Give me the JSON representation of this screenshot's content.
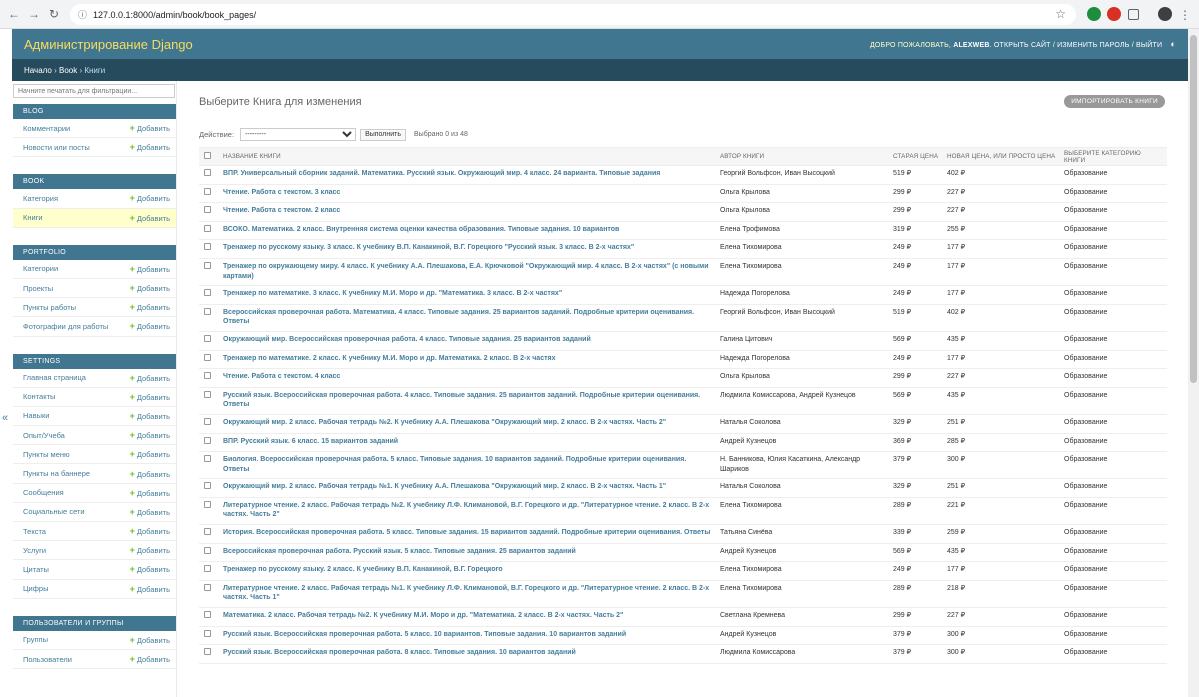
{
  "browser": {
    "url": "127.0.0.1:8000/admin/book/book_pages/"
  },
  "header": {
    "branding": "Администрирование Django",
    "welcome": "Добро пожаловать,",
    "username": "ALEXWEB",
    "view_site": "Открыть сайт",
    "change_password": "Изменить пароль",
    "logout": "Выйти"
  },
  "breadcrumbs": {
    "home": "Начало",
    "app": "Book",
    "current": "Книги"
  },
  "sidebar": {
    "filter_placeholder": "Начните печатать для фильтрации...",
    "add_label": "Добавить",
    "modules": [
      {
        "caption": "Blog",
        "items": [
          "Комментарии",
          "Новости или посты"
        ]
      },
      {
        "caption": "Book",
        "items": [
          "Категория",
          "Книги"
        ]
      },
      {
        "caption": "Portfolio",
        "items": [
          "Категории",
          "Проекты",
          "Пункты работы",
          "Фотографии для работы"
        ]
      },
      {
        "caption": "Settings",
        "items": [
          "Главная страница",
          "Контакты",
          "Навыки",
          "Опыт/Учеба",
          "Пункты меню",
          "Пункты на баннере",
          "Сообщения",
          "Социальные сети",
          "Текста",
          "Услуги",
          "Цитаты",
          "Цифры"
        ]
      },
      {
        "caption": "Пользователи и группы",
        "items": [
          "Группы",
          "Пользователи"
        ]
      }
    ]
  },
  "content": {
    "title": "Выберите Книга для изменения",
    "import_button": "Импортировать Книги",
    "action_label": "Действие:",
    "action_selected": "---------",
    "go_button": "Выполнить",
    "counter": "Выбрано 0 из 48",
    "columns": [
      "Название книги",
      "Автор книги",
      "Старая цена",
      "Новая цена, или просто цена",
      "Выберите категорию книги"
    ],
    "rows": [
      {
        "title": "ВПР. Универсальный сборник заданий. Математика. Русский язык. Окружающий мир. 4 класс. 24 варианта. Типовые задания",
        "author": "Георгий Вольфсон, Иван Высоцкий",
        "old": "519 ₽",
        "new": "402 ₽",
        "cat": "Образование"
      },
      {
        "title": "Чтение. Работа с текстом. 3 класс",
        "author": "Ольга Крылова",
        "old": "299 ₽",
        "new": "227 ₽",
        "cat": "Образование"
      },
      {
        "title": "Чтение. Работа с текстом. 2 класс",
        "author": "Ольга Крылова",
        "old": "299 ₽",
        "new": "227 ₽",
        "cat": "Образование"
      },
      {
        "title": "ВСОКО. Математика. 2 класс. Внутренняя система оценки качества образования. Типовые задания. 10 вариантов",
        "author": "Елена Трофимова",
        "old": "319 ₽",
        "new": "255 ₽",
        "cat": "Образование"
      },
      {
        "title": "Тренажер по русскому языку. 3 класс. К учебнику В.П. Канакиной, В.Г. Горецкого \"Русский язык. 3 класс. В 2-х частях\"",
        "author": "Елена Тихомирова",
        "old": "249 ₽",
        "new": "177 ₽",
        "cat": "Образование"
      },
      {
        "title": "Тренажер по окружающему миру. 4 класс. К учебнику А.А. Плешакова, Е.А. Крючковой \"Окружающий мир. 4 класс. В 2-х частях\" (с новыми картами)",
        "author": "Елена Тихомирова",
        "old": "249 ₽",
        "new": "177 ₽",
        "cat": "Образование"
      },
      {
        "title": "Тренажер по математике. 3 класс. К учебнику М.И. Моро и др. \"Математика. 3 класс. В 2-х частях\"",
        "author": "Надежда Погорелова",
        "old": "249 ₽",
        "new": "177 ₽",
        "cat": "Образование"
      },
      {
        "title": "Всероссийская проверочная работа. Математика. 4 класс. Типовые задания. 25 вариантов заданий. Подробные критерии оценивания. Ответы",
        "author": "Георгий Вольфсон, Иван Высоцкий",
        "old": "519 ₽",
        "new": "402 ₽",
        "cat": "Образование"
      },
      {
        "title": "Окружающий мир. Всероссийская проверочная работа. 4 класс. Типовые задания. 25 вариантов заданий",
        "author": "Галина Цитович",
        "old": "569 ₽",
        "new": "435 ₽",
        "cat": "Образование"
      },
      {
        "title": "Тренажер по математике. 2 класс. К учебнику М.И. Моро и др. Математика. 2 класс. В 2-х частях",
        "author": "Надежда Погорелова",
        "old": "249 ₽",
        "new": "177 ₽",
        "cat": "Образование"
      },
      {
        "title": "Чтение. Работа с текстом. 4 класс",
        "author": "Ольга Крылова",
        "old": "299 ₽",
        "new": "227 ₽",
        "cat": "Образование"
      },
      {
        "title": "Русский язык. Всероссийская проверочная работа. 4 класс. Типовые задания. 25 вариантов заданий. Подробные критерии оценивания. Ответы",
        "author": "Людмила Комиссарова, Андрей Кузнецов",
        "old": "569 ₽",
        "new": "435 ₽",
        "cat": "Образование"
      },
      {
        "title": "Окружающий мир. 2 класс. Рабочая тетрадь №2. К учебнику А.А. Плешакова \"Окружающий мир. 2 класс. В 2-х частях. Часть 2\"",
        "author": "Наталья Соколова",
        "old": "329 ₽",
        "new": "251 ₽",
        "cat": "Образование"
      },
      {
        "title": "ВПР. Русский язык. 6 класс. 15 вариантов заданий",
        "author": "Андрей Кузнецов",
        "old": "369 ₽",
        "new": "285 ₽",
        "cat": "Образование"
      },
      {
        "title": "Биология. Всероссийская проверочная работа. 5 класс. Типовые задания. 10 вариантов заданий. Подробные критерии оценивания. Ответы",
        "author": "Н. Банникова, Юлия Касаткина, Александр Шариков",
        "old": "379 ₽",
        "new": "300 ₽",
        "cat": "Образование"
      },
      {
        "title": "Окружающий мир. 2 класс. Рабочая тетрадь №1. К учебнику А.А. Плешакова \"Окружающий мир. 2 класс. В 2-х частях. Часть 1\"",
        "author": "Наталья Соколова",
        "old": "329 ₽",
        "new": "251 ₽",
        "cat": "Образование"
      },
      {
        "title": "Литературное чтение. 2 класс. Рабочая тетрадь №2. К учебнику Л.Ф. Климановой, В.Г. Горецкого и др. \"Литературное чтение. 2 класс. В 2-х частях. Часть 2\"",
        "author": "Елена Тихомирова",
        "old": "289 ₽",
        "new": "221 ₽",
        "cat": "Образование"
      },
      {
        "title": "История. Всероссийская проверочная работа. 5 класс. Типовые задания. 15 вариантов заданий. Подробные критерии оценивания. Ответы",
        "author": "Татьяна Синёва",
        "old": "339 ₽",
        "new": "259 ₽",
        "cat": "Образование"
      },
      {
        "title": "Всероссийская проверочная работа. Русский язык. 5 класс. Типовые задания. 25 вариантов заданий",
        "author": "Андрей Кузнецов",
        "old": "569 ₽",
        "new": "435 ₽",
        "cat": "Образование"
      },
      {
        "title": "Тренажер по русскому языку. 2 класс. К учебнику В.П. Канакиной, В.Г. Горецкого",
        "author": "Елена Тихомирова",
        "old": "249 ₽",
        "new": "177 ₽",
        "cat": "Образование"
      },
      {
        "title": "Литературное чтение. 2 класс. Рабочая тетрадь №1. К учебнику Л.Ф. Климановой, В.Г. Горецкого и др. \"Литературное чтение. 2 класс. В 2-х частях. Часть 1\"",
        "author": "Елена Тихомирова",
        "old": "289 ₽",
        "new": "218 ₽",
        "cat": "Образование"
      },
      {
        "title": "Математика. 2 класс. Рабочая тетрадь №2. К учебнику М.И. Моро и др. \"Математика. 2 класс. В 2-х частях. Часть 2\"",
        "author": "Светлана Кремнева",
        "old": "299 ₽",
        "new": "227 ₽",
        "cat": "Образование"
      },
      {
        "title": "Русский язык. Всероссийская проверочная работа. 5 класс. 10 вариантов. Типовые задания. 10 вариантов заданий",
        "author": "Андрей Кузнецов",
        "old": "379 ₽",
        "new": "300 ₽",
        "cat": "Образование"
      },
      {
        "title": "Русский язык. Всероссийская проверочная работа. 8 класс. Типовые задания. 10 вариантов заданий",
        "author": "Людмила Комиссарова",
        "old": "379 ₽",
        "new": "300 ₽",
        "cat": "Образование"
      }
    ]
  }
}
